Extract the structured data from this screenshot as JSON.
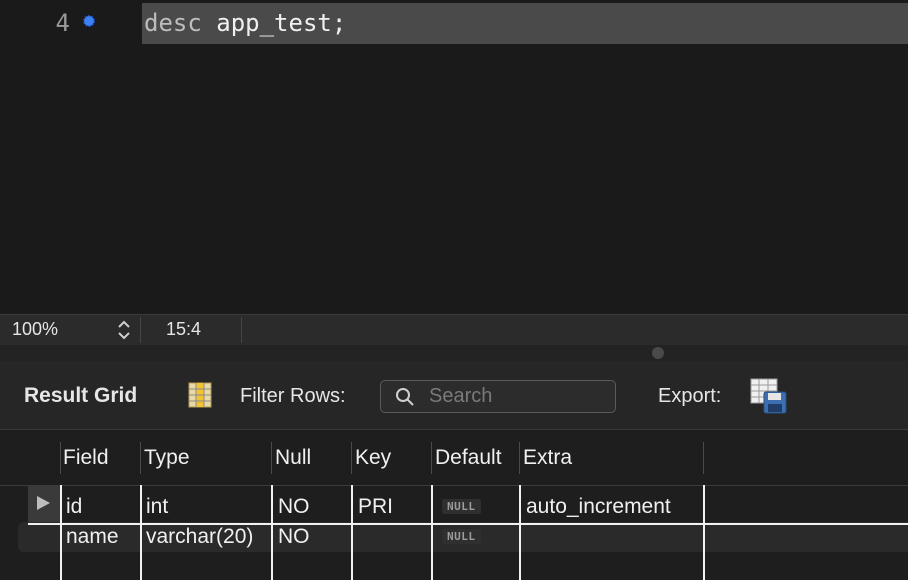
{
  "editor": {
    "line_number": "4",
    "code_keyword": "desc",
    "code_rest": " app_test;"
  },
  "status": {
    "zoom": "100%",
    "cursor_position": "15:4"
  },
  "toolbar": {
    "title": "Result Grid",
    "filter_label": "Filter Rows:",
    "search_placeholder": "Search",
    "export_label": "Export:"
  },
  "grid": {
    "columns": [
      "Field",
      "Type",
      "Null",
      "Key",
      "Default",
      "Extra"
    ],
    "rows": [
      {
        "field": "id",
        "type": "int",
        "null": "NO",
        "key": "PRI",
        "default": "NULL",
        "extra": "auto_increment"
      },
      {
        "field": "name",
        "type": "varchar(20)",
        "null": "NO",
        "key": "",
        "default": "NULL",
        "extra": ""
      }
    ]
  },
  "colors": {
    "accent": "#3b82f6",
    "editor_bg": "#1a1a1a",
    "line_highlight": "#4a4a4a"
  }
}
